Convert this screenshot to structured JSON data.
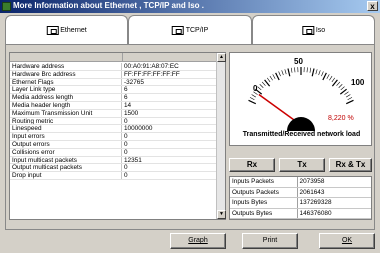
{
  "window": {
    "title": "More Information about Ethernet , TCP/IP and Iso .",
    "close_label": "x"
  },
  "tabs": [
    {
      "label": "Ethernet"
    },
    {
      "label": "TCP/IP"
    },
    {
      "label": "Iso"
    }
  ],
  "table": {
    "rows": [
      {
        "name": "Hardware address",
        "value": "00:A0:91:A8:07:EC"
      },
      {
        "name": "Hardware Brc address",
        "value": "FF:FF:FF:FF:FF:FF"
      },
      {
        "name": "Ethernet Flags",
        "value": "-32765"
      },
      {
        "name": "Layer Link type",
        "value": "6"
      },
      {
        "name": "Media address length",
        "value": "6"
      },
      {
        "name": "Media header length",
        "value": "14"
      },
      {
        "name": "Maximum Transmission Unit",
        "value": "1500"
      },
      {
        "name": "Routing metric",
        "value": "0"
      },
      {
        "name": "Linespeed",
        "value": "10000000"
      },
      {
        "name": "Input errors",
        "value": "0"
      },
      {
        "name": "Output errors",
        "value": "0"
      },
      {
        "name": "Collisions error",
        "value": "0"
      },
      {
        "name": "Input multicast packets",
        "value": "12351"
      },
      {
        "name": "Output multicast packets",
        "value": "0"
      },
      {
        "name": "Drop input",
        "value": "0"
      }
    ]
  },
  "gauge": {
    "ticks": [
      "0",
      "50",
      "100"
    ],
    "value_text": "8,220 %",
    "value_fraction": 0.0822,
    "caption": "Transmitted/Received network load",
    "needle_color": "#cc0000"
  },
  "mode_buttons": {
    "rx": "Rx",
    "tx": "Tx",
    "rxtx": "Rx & Tx"
  },
  "stats": [
    {
      "label": "Inputs Packets",
      "value": "2073958"
    },
    {
      "label": "Outputs Packets",
      "value": "2061643"
    },
    {
      "label": "Inputs Bytes",
      "value": "137269328"
    },
    {
      "label": "Outputs Bytes",
      "value": "146376080"
    }
  ],
  "bottom_buttons": {
    "graph": "Graph",
    "print": "Print",
    "ok": "OK"
  }
}
